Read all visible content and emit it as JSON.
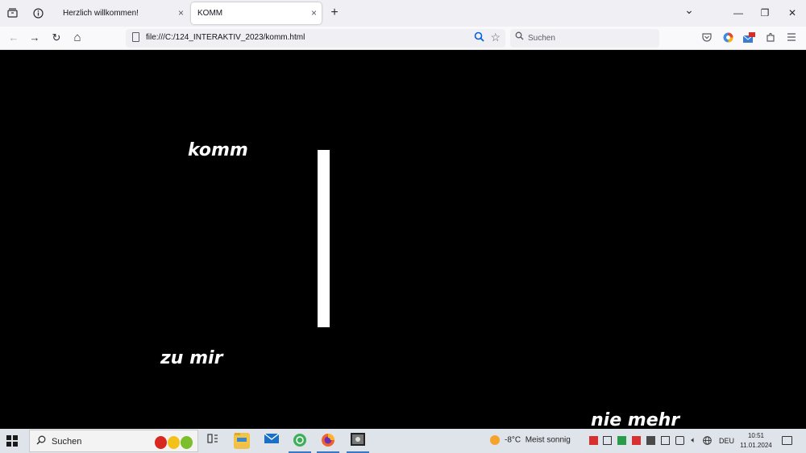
{
  "browser": {
    "tabs": [
      {
        "title": "Herzlich willkommen!",
        "active": false
      },
      {
        "title": "KOMM",
        "active": true
      }
    ],
    "new_tab_glyph": "+",
    "url": "file:///C:/124_INTERAKTIV_2023/komm.html",
    "search_placeholder": "Suchen",
    "icons": {
      "tab_list": "tab-overview-icon",
      "site_info": "info-icon",
      "close_tab": "×",
      "chevron": "⌄",
      "minimize": "—",
      "restore": "❐",
      "close_window": "✕",
      "back": "←",
      "forward": "→",
      "reload": "↻",
      "home": "⌂",
      "star": "☆",
      "zoom": "⚲"
    }
  },
  "page": {
    "words": [
      "komm",
      "zu mir",
      "nie mehr"
    ]
  },
  "taskbar": {
    "search_label": "Suchen",
    "weather_temp": "-8°C",
    "weather_text": "Meist sonnig",
    "language": "DEU",
    "time": "10:51",
    "date": "11.01.2024",
    "colors": {
      "taskbar_bg": "#dfe3ea",
      "accent": "#3b78c4"
    }
  }
}
